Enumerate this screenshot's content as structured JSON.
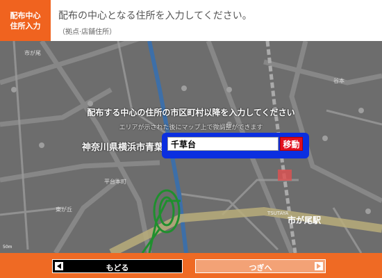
{
  "header": {
    "step_line1": "配布中心",
    "step_line2": "住所入力",
    "title": "配布の中心となる住所を入力してください。",
    "subtitle": "（拠点·店舗住所）"
  },
  "map": {
    "station_label": "市が尾駅",
    "place_labels": [
      "平台本町",
      "東が丘",
      "市が尾",
      "谷本",
      "TSUTAYA"
    ],
    "scale_label": "50m"
  },
  "form": {
    "prompt_main": "配布する中心の住所の市区町村以降を入力してください",
    "prompt_sub": "エリアが示された後にマップ上で微調整ができます",
    "prefix": "神奈川県横浜市青葉区",
    "address_value": "千草台",
    "move_label": "移動"
  },
  "footer": {
    "back_label": "もどる",
    "next_label": "つぎへ"
  },
  "colors": {
    "accent_orange": "#f0631f",
    "input_frame_blue": "#0b2fe0",
    "move_red": "#e10f1e"
  }
}
